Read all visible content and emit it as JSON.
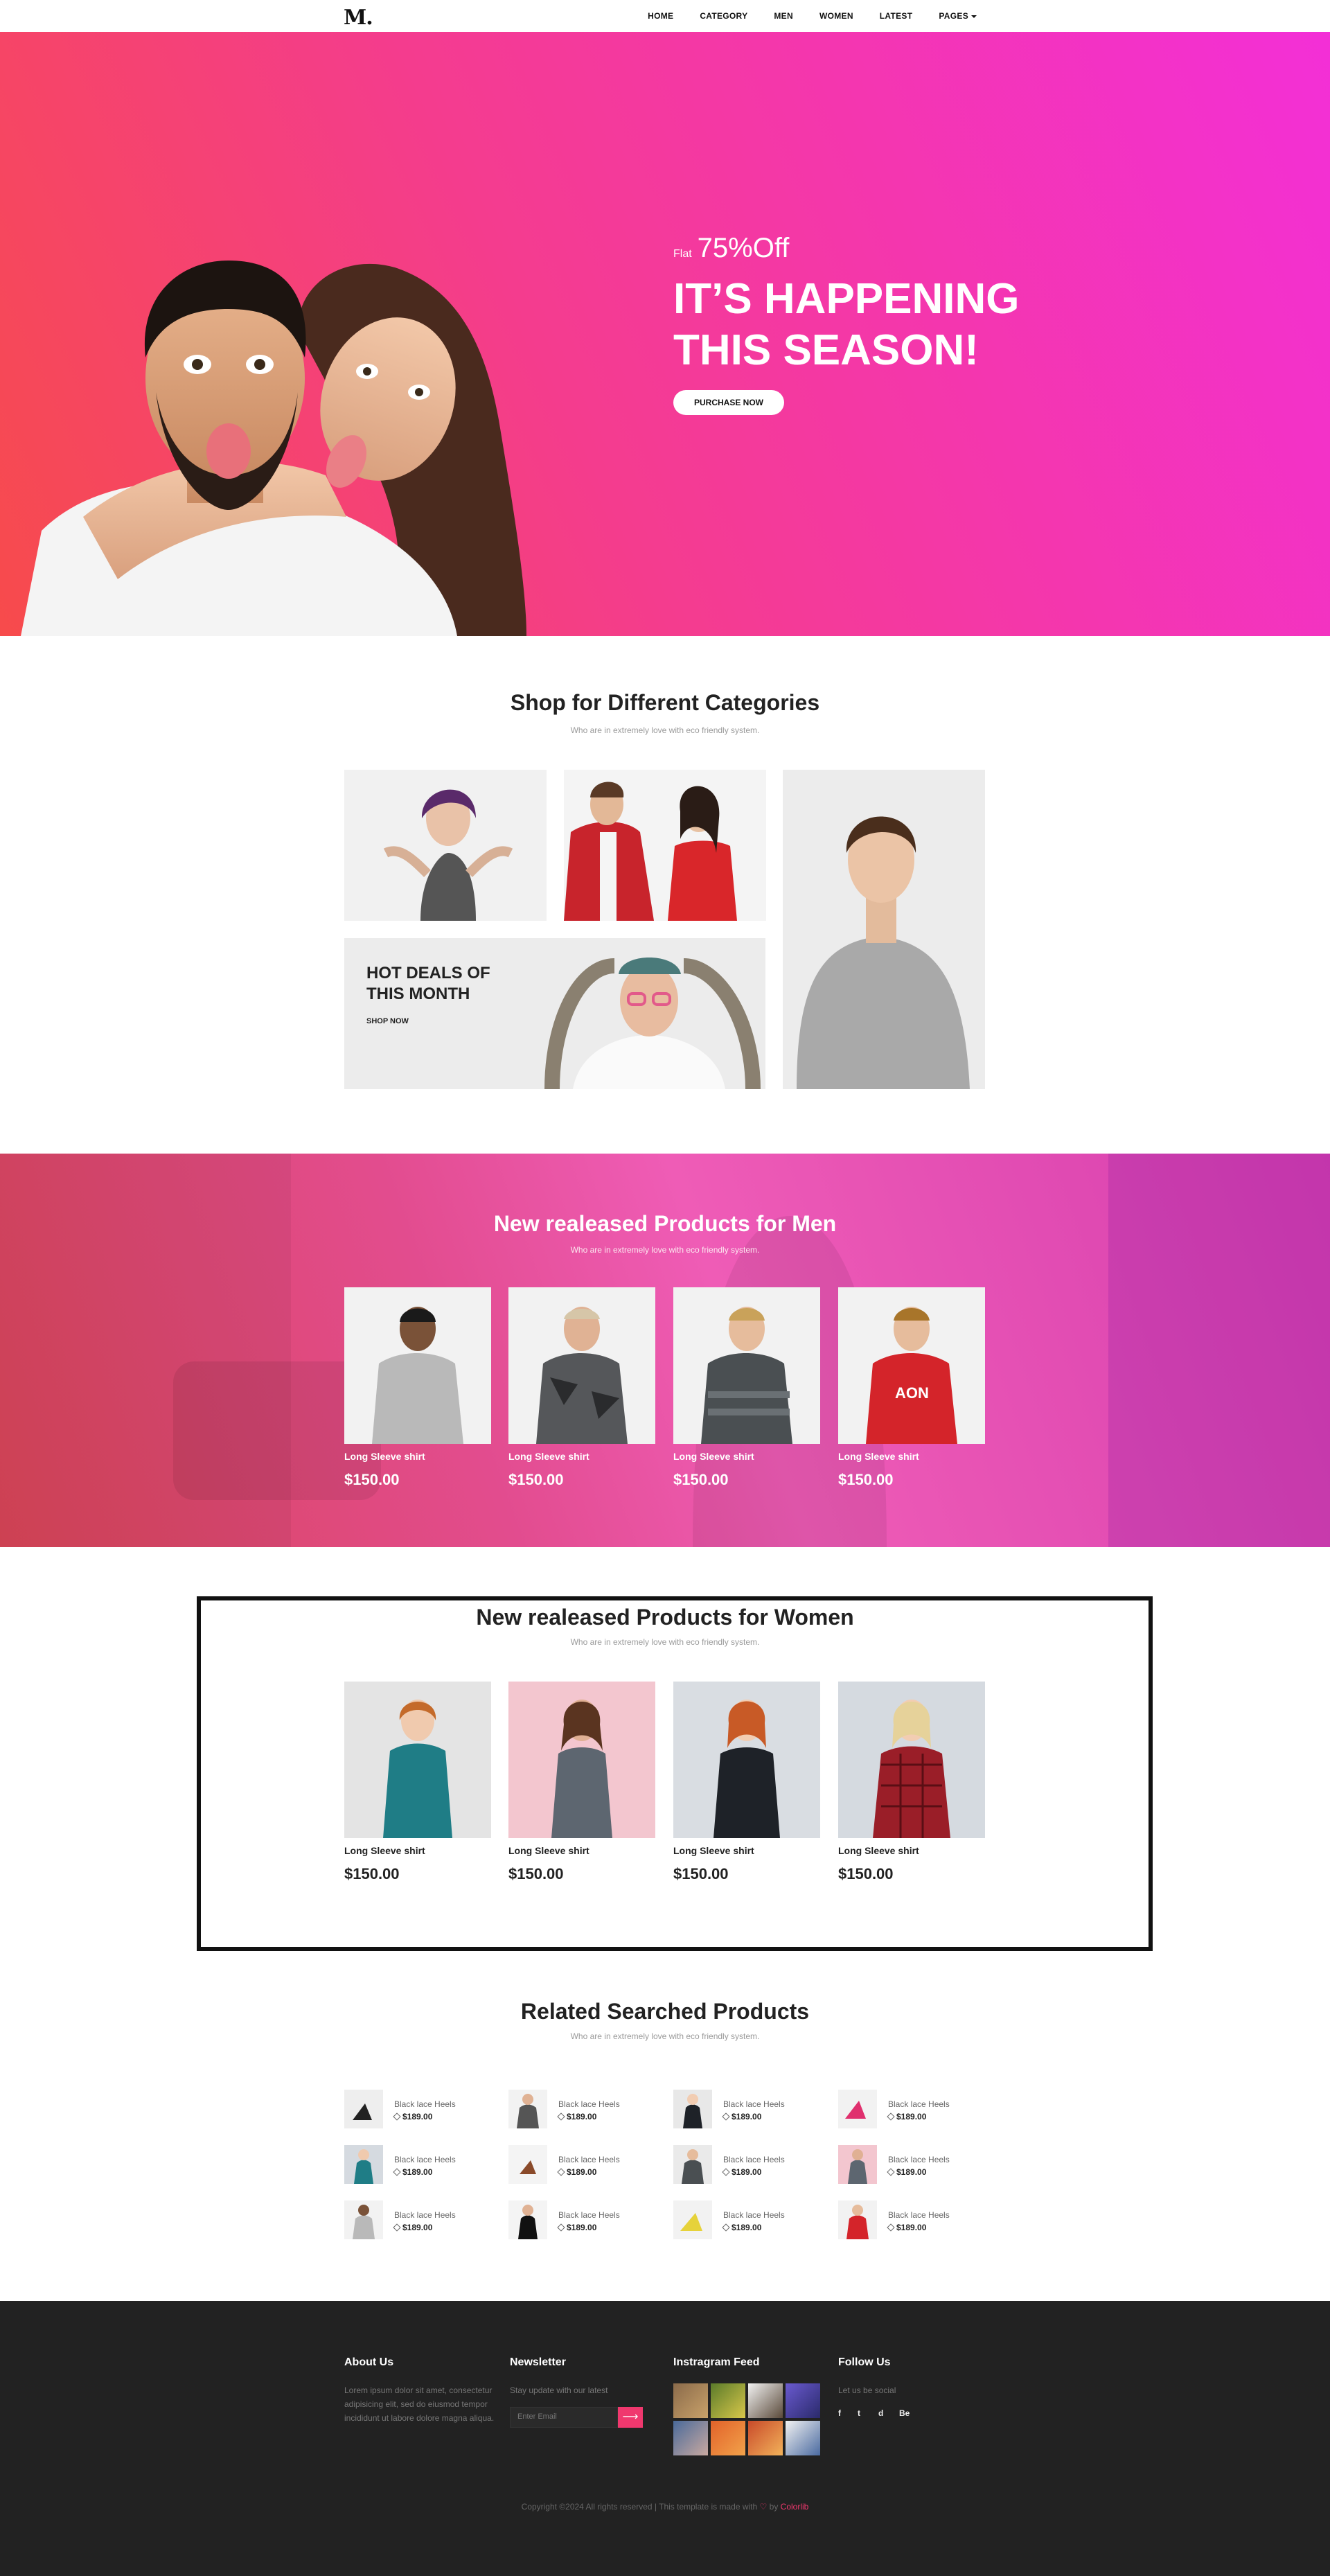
{
  "nav": {
    "logo": "M.",
    "items": [
      "HOME",
      "CATEGORY",
      "MEN",
      "WOMEN",
      "LATEST",
      "PAGES"
    ]
  },
  "hero": {
    "flat_label": "Flat",
    "discount": "75%Off",
    "title_line1": "IT’S HAPPENING",
    "title_line2": "THIS SEASON!",
    "button": "PURCHASE NOW"
  },
  "categories": {
    "title": "Shop for Different Categories",
    "subtitle": "Who are in extremely love with eco friendly system.",
    "deal_title": "HOT DEALS OF THIS MONTH",
    "deal_button": "SHOP NOW"
  },
  "men": {
    "title": "New realeased Products for Men",
    "subtitle": "Who are in extremely love with eco friendly system.",
    "products": [
      {
        "name": "Long Sleeve shirt",
        "price": "$150.00"
      },
      {
        "name": "Long Sleeve shirt",
        "price": "$150.00"
      },
      {
        "name": "Long Sleeve shirt",
        "price": "$150.00"
      },
      {
        "name": "Long Sleeve shirt",
        "price": "$150.00"
      }
    ]
  },
  "women": {
    "title": "New realeased Products for Women",
    "subtitle": "Who are in extremely love with eco friendly system.",
    "products": [
      {
        "name": "Long Sleeve shirt",
        "price": "$150.00"
      },
      {
        "name": "Long Sleeve shirt",
        "price": "$150.00"
      },
      {
        "name": "Long Sleeve shirt",
        "price": "$150.00"
      },
      {
        "name": "Long Sleeve shirt",
        "price": "$150.00"
      }
    ]
  },
  "related": {
    "title": "Related Searched Products",
    "subtitle": "Who are in extremely love with eco friendly system.",
    "items": [
      {
        "name": "Black lace Heels",
        "price": "$189.00"
      },
      {
        "name": "Black lace Heels",
        "price": "$189.00"
      },
      {
        "name": "Black lace Heels",
        "price": "$189.00"
      },
      {
        "name": "Black lace Heels",
        "price": "$189.00"
      },
      {
        "name": "Black lace Heels",
        "price": "$189.00"
      },
      {
        "name": "Black lace Heels",
        "price": "$189.00"
      },
      {
        "name": "Black lace Heels",
        "price": "$189.00"
      },
      {
        "name": "Black lace Heels",
        "price": "$189.00"
      },
      {
        "name": "Black lace Heels",
        "price": "$189.00"
      },
      {
        "name": "Black lace Heels",
        "price": "$189.00"
      },
      {
        "name": "Black lace Heels",
        "price": "$189.00"
      },
      {
        "name": "Black lace Heels",
        "price": "$189.00"
      }
    ]
  },
  "footer": {
    "about_title": "About Us",
    "about_text": "Lorem ipsum dolor sit amet, consectetur adipisicing elit, sed do eiusmod tempor incididunt ut labore dolore magna aliqua.",
    "newsletter_title": "Newsletter",
    "newsletter_text": "Stay update with our latest",
    "email_placeholder": "Enter Email",
    "instagram_title": "Instragram Feed",
    "follow_title": "Follow Us",
    "follow_text": "Let us be social",
    "social": [
      "f",
      "t",
      "d",
      "Be"
    ],
    "copyright": "Copyright ©2024 All rights reserved | This template is made with",
    "by": "by",
    "brand": "Colorlib"
  },
  "colors": {
    "accent": "#f0386e",
    "hero_start": "#f74b4b",
    "hero_end": "#f32fd7",
    "footer_bg": "#222222"
  }
}
